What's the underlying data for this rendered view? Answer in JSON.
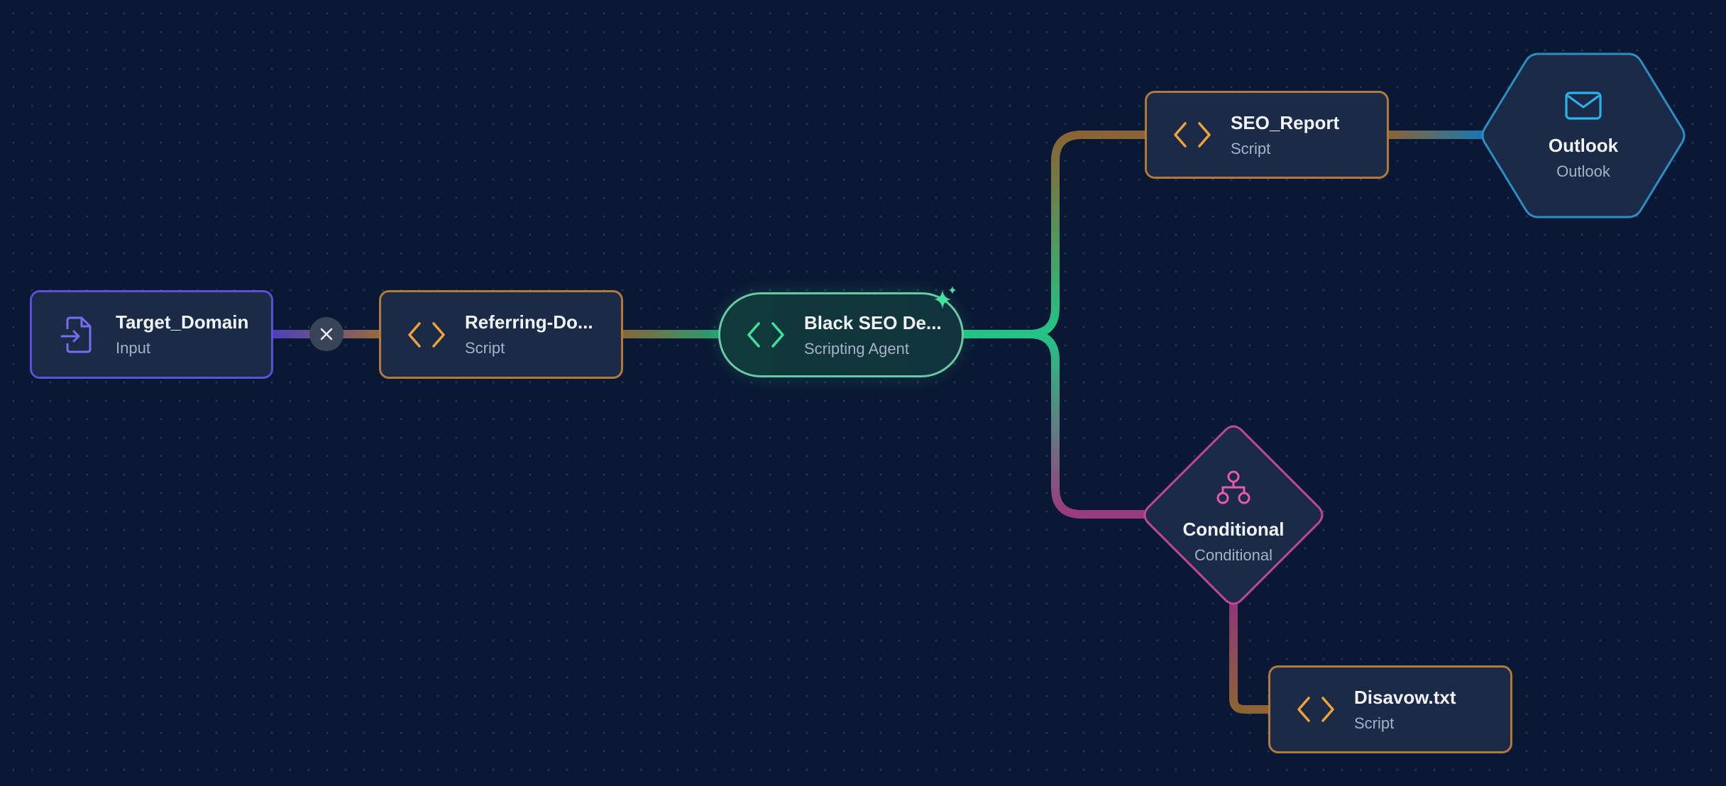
{
  "colors": {
    "input": "#5b50d6",
    "script": "#b07a3a",
    "agent": "#6ac9a4",
    "conditional": "#c04a91",
    "outlook": "#2b8fc6",
    "script_icon": "#f1a23a",
    "agent_icon": "#3fe39e",
    "input_icon": "#7a6cf0",
    "conditional_icon": "#e95aa8",
    "outlook_icon": "#2fb0e8"
  },
  "nodes": {
    "target_domain": {
      "title": "Target_Domain",
      "subtitle": "Input",
      "icon": "file-import-icon"
    },
    "referring_domains": {
      "title": "Referring-Do...",
      "subtitle": "Script",
      "icon": "code-brackets-icon"
    },
    "black_seo": {
      "title": "Black SEO De...",
      "subtitle": "Scripting Agent",
      "icon": "code-brackets-icon",
      "badge": "sparkle-icon"
    },
    "seo_report": {
      "title": "SEO_Report",
      "subtitle": "Script",
      "icon": "code-brackets-icon"
    },
    "outlook": {
      "title": "Outlook",
      "subtitle": "Outlook",
      "icon": "envelope-icon"
    },
    "conditional": {
      "title": "Conditional",
      "subtitle": "Conditional",
      "icon": "sitemap-icon"
    },
    "disavow": {
      "title": "Disavow.txt",
      "subtitle": "Script",
      "icon": "code-brackets-icon"
    }
  },
  "edges": [
    {
      "from": "target_domain",
      "to": "referring_domains",
      "control": "close-icon"
    },
    {
      "from": "referring_domains",
      "to": "black_seo"
    },
    {
      "from": "black_seo",
      "to": "seo_report"
    },
    {
      "from": "black_seo",
      "to": "conditional"
    },
    {
      "from": "seo_report",
      "to": "outlook"
    },
    {
      "from": "conditional",
      "to": "disavow"
    }
  ]
}
